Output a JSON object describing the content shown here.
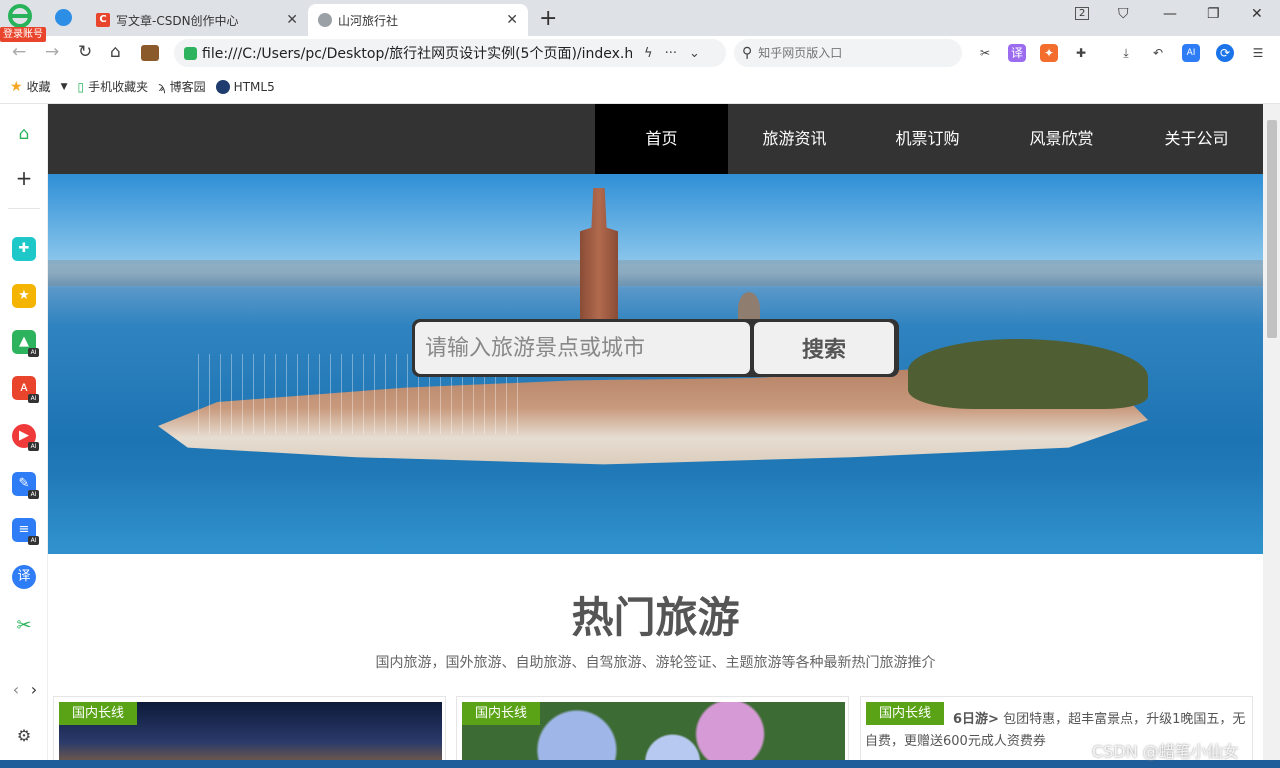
{
  "browser": {
    "login_badge": "登录账号",
    "tabs": [
      {
        "title": "写文章-CSDN创作中心",
        "favicon": "C"
      },
      {
        "title": "山河旅行社"
      }
    ],
    "url": "file:///C:/Users/pc/Desktop/旅行社网页设计实例(5个页面)/index.h",
    "search_placeholder": "知乎网页版入口",
    "tab_count": "2",
    "bookmarks": [
      "收藏",
      "手机收藏夹",
      "博客园",
      "HTML5"
    ]
  },
  "site": {
    "nav": [
      "首页",
      "旅游资讯",
      "机票订购",
      "风景欣赏",
      "关于公司"
    ],
    "search_placeholder": "请输入旅游景点或城市",
    "search_button": "搜索",
    "section_title": "热门旅游",
    "section_subtitle": "国内旅游，国外旅游、自助旅游、自驾旅游、游轮签证、主题旅游等各种最新热门旅游推介",
    "cards": [
      {
        "tag": "国内长线"
      },
      {
        "tag": "国内长线"
      },
      {
        "tag": "国内长线",
        "text_bold": "6日游>",
        "text": " 包团特惠，超丰富景点，升级1晚国五，无自费，更赠送600元成人资费券"
      }
    ],
    "accent_color": "#5aa317"
  },
  "watermark": "CSDN @蜡笔小仙女"
}
